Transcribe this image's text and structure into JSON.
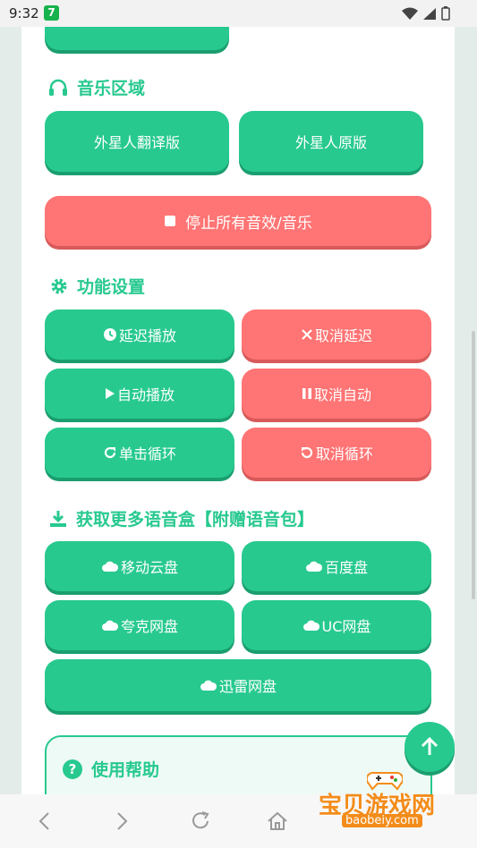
{
  "status_bar": {
    "time": "9:32",
    "badge": "7"
  },
  "sections": {
    "music": {
      "title": "音乐区域",
      "buttons": [
        "外星人翻译版",
        "外星人原版"
      ],
      "stop_button": "停止所有音效/音乐"
    },
    "settings": {
      "title": "功能设置",
      "delay_play": "延迟播放",
      "cancel_delay": "取消延迟",
      "auto_play": "自动播放",
      "cancel_auto": "取消自动",
      "single_loop": "单击循环",
      "cancel_loop": "取消循环"
    },
    "download": {
      "title": "获取更多语音盒【附赠语音包】",
      "links": [
        "移动云盘",
        "百度盘",
        "夸克网盘",
        "UC网盘",
        "迅雷网盘"
      ]
    },
    "help": {
      "title": "使用帮助",
      "icon": "?"
    }
  },
  "watermark": {
    "text": "宝贝游戏网",
    "url": "baobeiy.com"
  },
  "colors": {
    "green": "#27c98f",
    "red": "#ff7474"
  }
}
